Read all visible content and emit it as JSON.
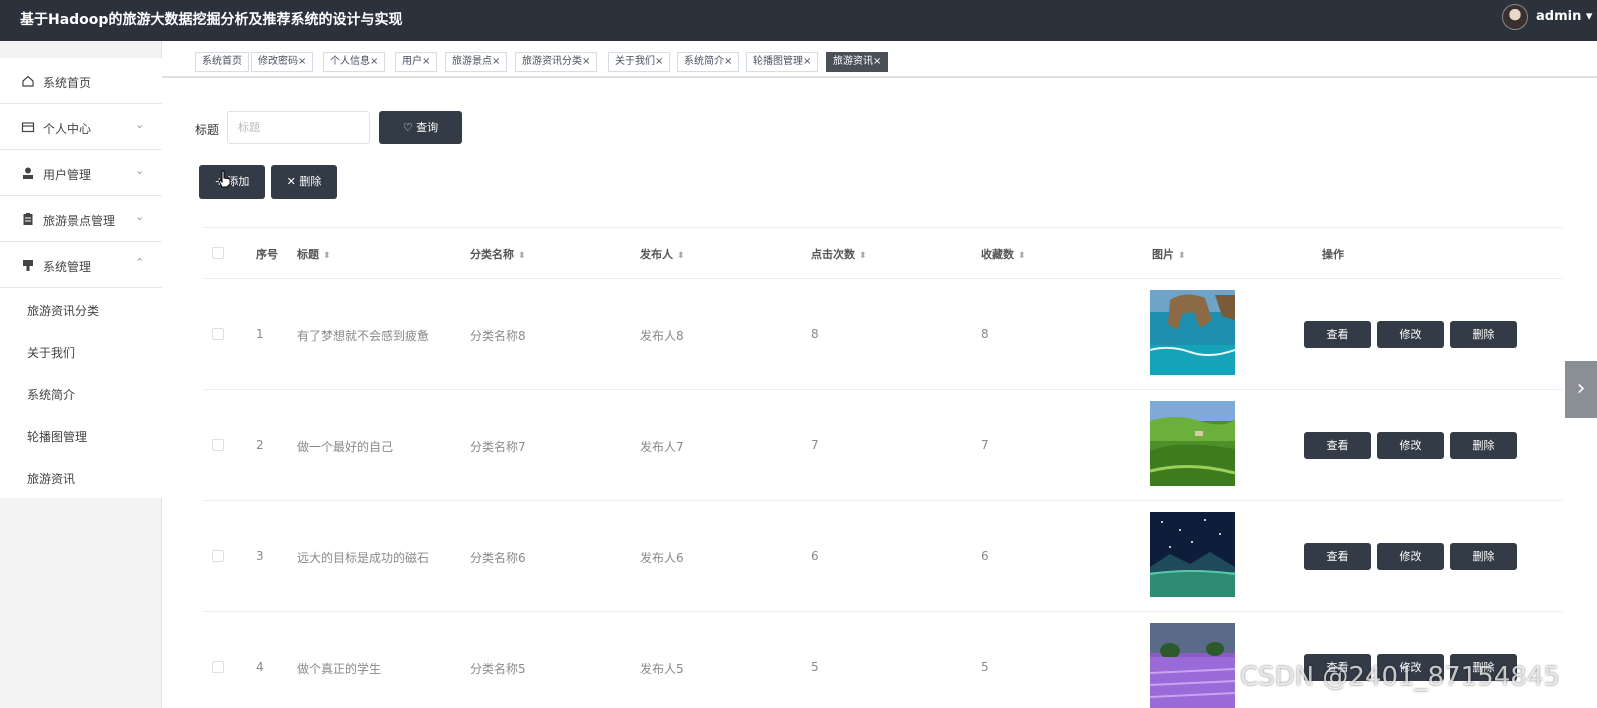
{
  "header": {
    "title": "基于Hadoop的旅游大数据挖掘分析及推荐系统的设计与实现",
    "user": "admin ▾"
  },
  "sidebar": {
    "items": [
      {
        "label": "系统首页",
        "icon": "home-icon"
      },
      {
        "label": "个人中心",
        "icon": "card-icon"
      },
      {
        "label": "用户管理",
        "icon": "user-icon"
      },
      {
        "label": "旅游景点管理",
        "icon": "clipboard-icon"
      },
      {
        "label": "系统管理",
        "icon": "settings-icon"
      }
    ],
    "subitems": [
      "旅游资讯分类",
      "关于我们",
      "系统简介",
      "轮播图管理",
      "旅游资讯"
    ]
  },
  "tabs": [
    "系统首页",
    "修改密码",
    "个人信息",
    "用户",
    "旅游景点",
    "旅游资讯分类",
    "关于我们",
    "系统简介",
    "轮播图管理",
    "旅游资讯"
  ],
  "search": {
    "label": "标题",
    "placeholder": "标题",
    "query_label": "♡ 查询"
  },
  "toolbar": {
    "add_label": "+ 添加",
    "delete_label": "✕ 删除"
  },
  "table": {
    "headers": [
      "序号",
      "标题",
      "分类名称",
      "发布人",
      "点击次数",
      "收藏数",
      "图片",
      "操作"
    ],
    "rows": [
      {
        "index": "1",
        "title": "有了梦想就不会感到疲惫",
        "category": "分类名称8",
        "author": "发布人8",
        "clicks": "8",
        "favorites": "8"
      },
      {
        "index": "2",
        "title": "做一个最好的自己",
        "category": "分类名称7",
        "author": "发布人7",
        "clicks": "7",
        "favorites": "7"
      },
      {
        "index": "3",
        "title": "远大的目标是成功的磁石",
        "category": "分类名称6",
        "author": "发布人6",
        "clicks": "6",
        "favorites": "6"
      },
      {
        "index": "4",
        "title": "做个真正的学生",
        "category": "分类名称5",
        "author": "发布人5",
        "clicks": "5",
        "favorites": "5"
      }
    ],
    "actions": {
      "view": "查看",
      "edit": "修改",
      "delete": "删除"
    }
  },
  "watermark": "CSDN @2401_87154845",
  "colors": {
    "header_bg": "#2b323c",
    "button_dark": "#333b46",
    "active_tab": "#4a5058"
  }
}
